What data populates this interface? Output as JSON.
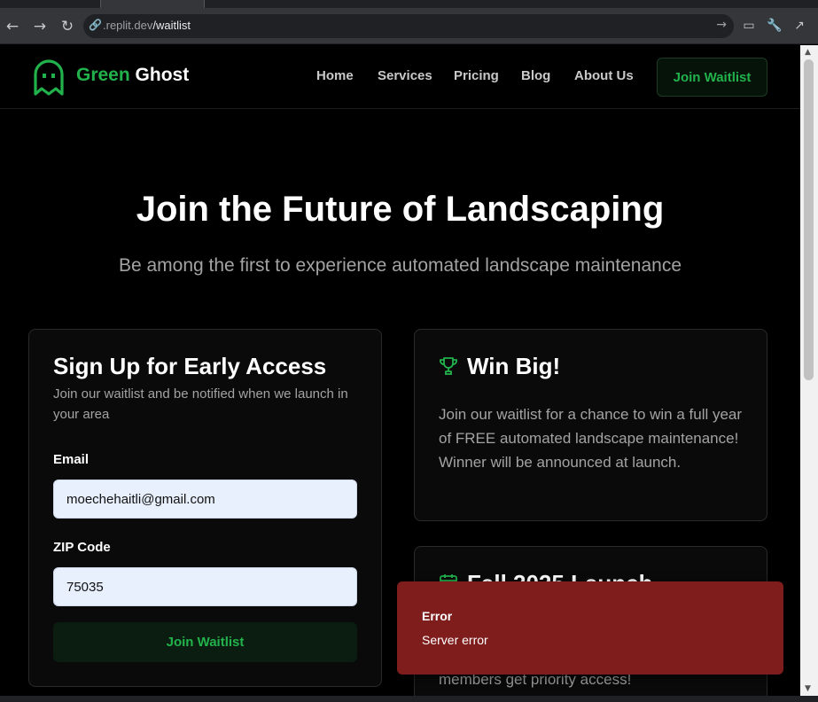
{
  "browser": {
    "url_host": ".replit.dev",
    "url_path": "/waitlist"
  },
  "header": {
    "brand_first": "Green",
    "brand_second": " Ghost",
    "nav": [
      "Home",
      "Services",
      "Pricing",
      "Blog",
      "About Us"
    ],
    "cta": "Join Waitlist"
  },
  "hero": {
    "title": "Join the Future of Landscaping",
    "subtitle": "Be among the first to experience automated landscape maintenance"
  },
  "signup": {
    "title": "Sign Up for Early Access",
    "description": "Join our waitlist and be notified when we launch in your area",
    "email_label": "Email",
    "email_value": "moechehaitli@gmail.com",
    "zip_label": "ZIP Code",
    "zip_value": "75035",
    "submit": "Join Waitlist"
  },
  "win": {
    "title": "Win Big!",
    "body": "Join our waitlist for a chance to win a full year of FREE automated landscape maintenance! Winner will be announced at launch."
  },
  "launch": {
    "title": "Fall 2025 Launch",
    "body": "members get priority access!"
  },
  "toast": {
    "title": "Error",
    "message": "Server error"
  },
  "colors": {
    "accent": "#22b24c",
    "toast_bg": "#7f1d1d"
  }
}
